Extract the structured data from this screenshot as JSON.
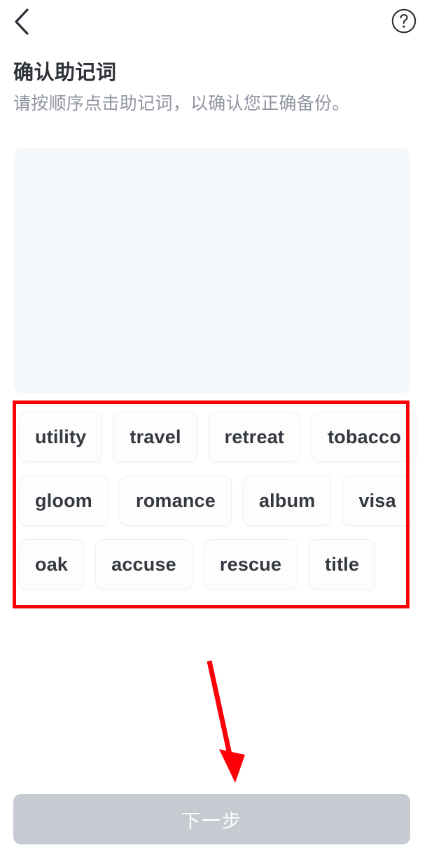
{
  "navbar": {
    "back_icon": "chevron-left-icon",
    "help_icon": "question-circle-icon"
  },
  "header": {
    "title": "确认助记词",
    "subtitle": "请按顺序点击助记词，以确认您正确备份。"
  },
  "selection_area": {
    "selected_words": [],
    "placeholder": ""
  },
  "word_pool": {
    "rows": [
      [
        "utility",
        "travel",
        "retreat",
        "tobacco"
      ],
      [
        "gloom",
        "romance",
        "album",
        "visa"
      ],
      [
        "oak",
        "accuse",
        "rescue",
        "title"
      ]
    ]
  },
  "footer": {
    "next_label": "下一步"
  },
  "annotations": {
    "highlight_box_color": "#fb0006",
    "arrow_color": "#fb0006"
  },
  "colors": {
    "page_bg": "#ffffff",
    "title_text": "#2e3138",
    "subtitle_text": "#9094a0",
    "selection_box_bg": "#f5f8fa",
    "chip_bg": "#fdfdfe",
    "chip_border": "#f0f1f4",
    "chip_text": "#34383f",
    "button_bg": "#c6cad1",
    "button_text": "#ffffff"
  }
}
